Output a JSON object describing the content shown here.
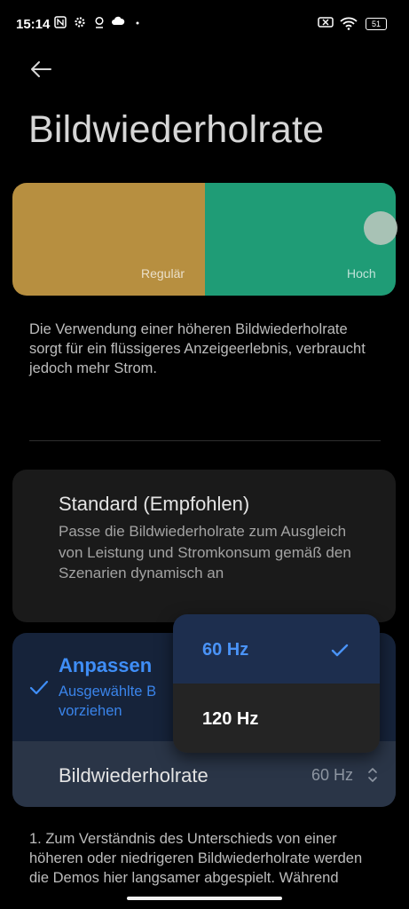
{
  "status_bar": {
    "time": "15:14",
    "battery": "51",
    "icons_left": [
      "nfc-icon",
      "gear-icon",
      "location-icon",
      "cloud-icon",
      "dot-icon"
    ],
    "icons_right": [
      "no-sim-icon",
      "wifi-icon",
      "battery-icon"
    ]
  },
  "header": {
    "back_icon": "arrow-left-icon",
    "title": "Bildwiederholrate"
  },
  "demo": {
    "left_label": "Regulär",
    "right_label": "Hoch",
    "left_color": "#b78f40",
    "right_color": "#1f9c76"
  },
  "description": "Die Verwendung einer höheren Bildwiederholrate sorgt für ein flüssigeres Anzeigeerlebnis, verbraucht jedoch mehr Strom.",
  "standard_option": {
    "title": "Standard (Empfohlen)",
    "description": "Passe die Bildwiederholrate zum Ausgleich von Leistung und Stromkonsum gemäß den Szenarien dynamisch an"
  },
  "custom_option": {
    "title": "Anpassen",
    "description": "Ausgewählte B vorziehen",
    "selected": true,
    "rate_row": {
      "label": "Bildwiederholrate",
      "value": "60 Hz"
    }
  },
  "dropdown": {
    "options": [
      {
        "label": "60 Hz",
        "selected": true
      },
      {
        "label": "120 Hz",
        "selected": false
      }
    ]
  },
  "footnote": "1. Zum Verständnis des Unterschieds von einer höheren oder niedrigeren Bildwiederholrate werden die Demos hier langsamer abgespielt. Während",
  "colors": {
    "accent": "#3f8ef7",
    "background": "#000000"
  }
}
